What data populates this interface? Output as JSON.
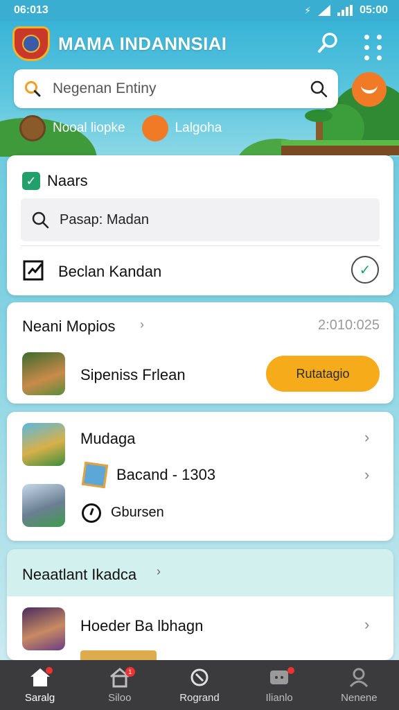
{
  "status_bar": {
    "time": "06:013",
    "clock": "05:00"
  },
  "header": {
    "title": "MAMA INDANNSIAI",
    "search_placeholder": "Negenan Entiny",
    "quick_items": [
      "Nooal liopke",
      "Lalgoha"
    ]
  },
  "card_settings": {
    "title": "Naars",
    "search_text": "Pasap: Madan",
    "option_label": "Beclan Kandan"
  },
  "card_recent": {
    "title": "Neani Mopios",
    "date": "2:010:025",
    "game_name": "Sipeniss Frlean",
    "play_button": "Rutatagio"
  },
  "card_list": {
    "title": "Mudaga",
    "items": [
      "Bacand - 1303",
      "Gbursen"
    ]
  },
  "card_recommended": {
    "title": "Neaatlant Ikadca",
    "item_name": "Hoeder Ba lbhagn"
  },
  "bottom_nav": [
    {
      "label": "Saralg",
      "icon": "home-icon"
    },
    {
      "label": "Siloo",
      "icon": "store-icon",
      "badge": "1"
    },
    {
      "label": "Rogrand",
      "icon": "refresh-icon"
    },
    {
      "label": "Ilianlo",
      "icon": "chat-icon"
    },
    {
      "label": "Nenene",
      "icon": "profile-icon"
    }
  ],
  "colors": {
    "accent": "#f6ac1a",
    "header": "#38b3d6",
    "success": "#22a06b",
    "nav": "#3b3b3d"
  }
}
